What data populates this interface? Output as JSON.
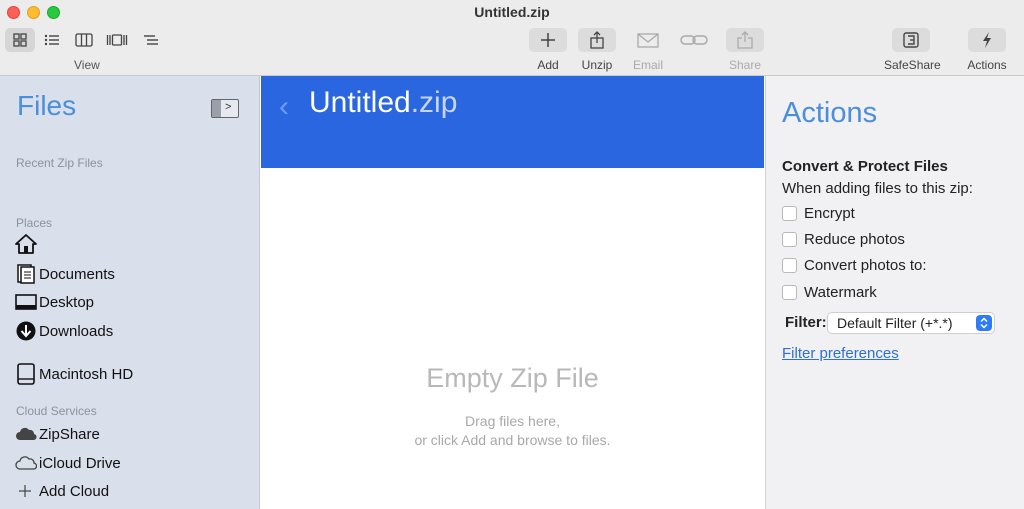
{
  "window": {
    "title": "Untitled.zip"
  },
  "toolbar": {
    "view_label": "View",
    "view_modes": [
      "grid-view-icon",
      "list-view-icon",
      "columns-view-icon",
      "gallery-view-icon",
      "outline-view-icon"
    ],
    "add_label": "Add",
    "unzip_label": "Unzip",
    "email_label": "Email",
    "link_label": "",
    "share_label": "Share",
    "safeshare_label": "SafeShare",
    "actions_label": "Actions"
  },
  "sidebar": {
    "title": "Files",
    "recent_label": "Recent Zip Files",
    "places_label": "Places",
    "places": [
      {
        "label": "",
        "icon": "home-icon"
      },
      {
        "label": "Documents",
        "icon": "documents-icon"
      },
      {
        "label": "Desktop",
        "icon": "desktop-icon"
      },
      {
        "label": "Downloads",
        "icon": "downloads-icon"
      },
      {
        "label": "Macintosh HD",
        "icon": "hard-drive-icon"
      }
    ],
    "cloud_label": "Cloud Services",
    "cloud": [
      {
        "label": "ZipShare",
        "icon": "zipshare-cloud-icon"
      },
      {
        "label": "iCloud Drive",
        "icon": "icloud-icon"
      },
      {
        "label": "Add Cloud",
        "icon": "plus-icon"
      }
    ]
  },
  "main": {
    "banner_name": "Untitled",
    "banner_ext": ".zip",
    "empty_title": "Empty Zip File",
    "empty_line1": "Drag files here,",
    "empty_line2": "or click Add and browse to files.",
    "banner_color": "#2a66e0"
  },
  "actions": {
    "title": "Actions",
    "heading": "Convert & Protect Files",
    "subheading": "When adding files to this zip:",
    "options": [
      {
        "label": "Encrypt",
        "checked": false
      },
      {
        "label": "Reduce photos",
        "checked": false
      },
      {
        "label": "Convert photos to:",
        "checked": false
      },
      {
        "label": "Watermark",
        "checked": false
      }
    ],
    "filter_label": "Filter:",
    "filter_value": "Default Filter (+*.*)",
    "filter_link": "Filter preferences",
    "accent_color": "#4a8fd9"
  }
}
